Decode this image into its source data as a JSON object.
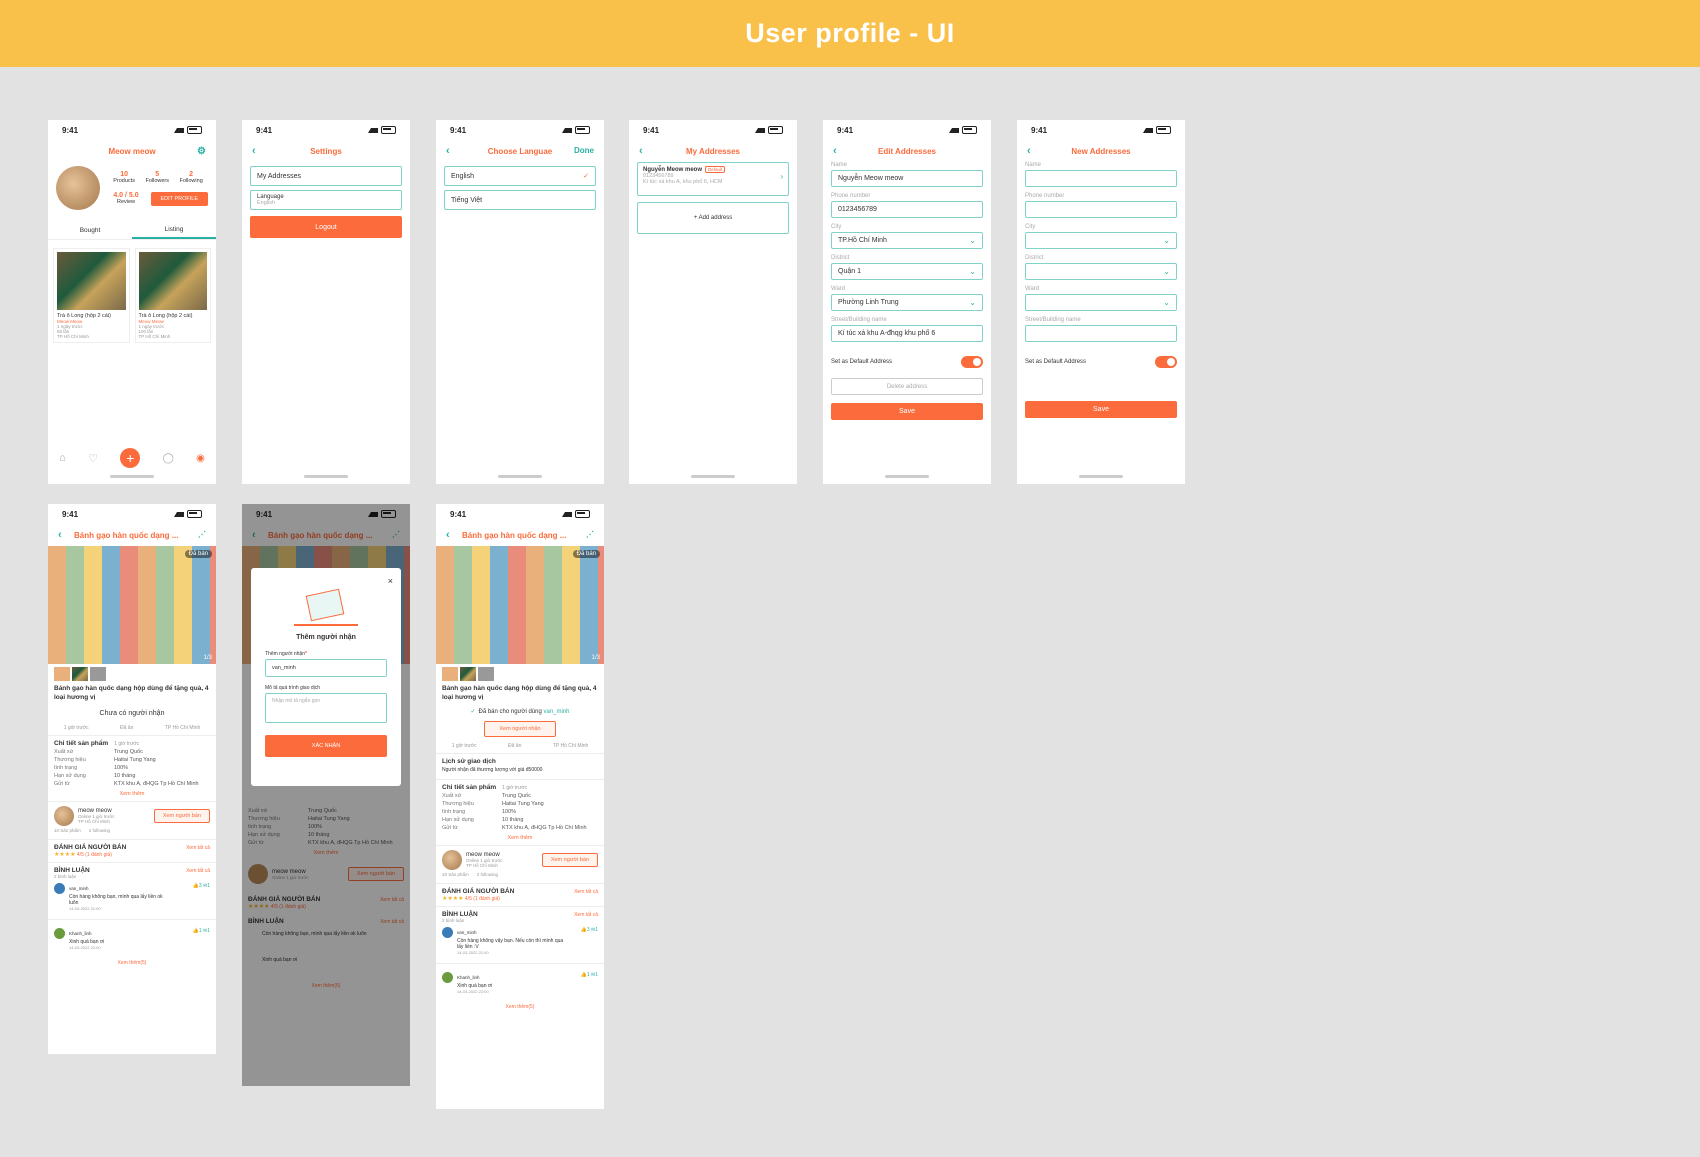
{
  "banner": {
    "title": "User profile - UI"
  },
  "status": {
    "time": "9:41"
  },
  "profile": {
    "title": "Meow meow",
    "stats": [
      {
        "value": "10",
        "label": "Products"
      },
      {
        "value": "5",
        "label": "Followers"
      },
      {
        "value": "2",
        "label": "Following"
      }
    ],
    "rating": "4.0 / 5.0",
    "rating_label": "Review",
    "edit_button": "EDIT PROFILE",
    "tabs": [
      "Bought",
      "Listing"
    ],
    "products": [
      {
        "name": "Trà ô Long (hộp 2 cái)",
        "seller": "Meow Meow",
        "time": "1 ngày trước",
        "sold": "65 lần",
        "location": "TP Hồ Chí Minh"
      },
      {
        "name": "Trà ô Long (hộp 2 cái)",
        "seller": "Meow Meow",
        "time": "1 ngày trước",
        "sold": "100 lần",
        "location": "TP Hồ Chí Minh"
      }
    ]
  },
  "settings": {
    "title": "Settings",
    "my_addresses": "My Addresses",
    "language": "Language",
    "language_value": "English",
    "logout": "Logout"
  },
  "choose_language": {
    "title": "Choose Languae",
    "done": "Done",
    "options": [
      "English",
      "Tiếng Việt"
    ]
  },
  "my_addresses": {
    "title": "My Addresses",
    "name": "Nguyễn Meow meow",
    "badge": "Default",
    "phone": "0123456789",
    "address": "Kí túc xá khu A, khu phố 6, HCM",
    "add": "+ Add address"
  },
  "edit_address": {
    "title": "Edit Addresses",
    "labels": {
      "name": "Name",
      "phone": "Phone number",
      "city": "City",
      "district": "District",
      "ward": "Ward",
      "street": "Street/Building name"
    },
    "values": {
      "name": "Nguyễn Meow meow",
      "phone": "0123456789",
      "city": "TP.Hồ Chí Minh",
      "district": "Quận 1",
      "ward": "Phường Linh Trung",
      "street": "Kí túc xá khu A-đhqg khu phố 6"
    },
    "default_label": "Set as Default Address",
    "delete": "Delete address",
    "save": "Save"
  },
  "new_address": {
    "title": "New Addresses",
    "default_label": "Set as Default Address",
    "save": "Save"
  },
  "product": {
    "title": "Bánh gạo hàn quốc dạng ...",
    "badge": "Đã bán",
    "counter": "1/3",
    "name": "Bánh gạo hàn quốc dạng hộp dùng để tặng quà, 4 loại hương vị",
    "no_receiver": "Chưa có người nhận",
    "meta": [
      "1 giờ trước",
      "Đã ăn",
      "TP Hồ Chí Minh"
    ],
    "details_title": "Chi tiết sản phẩm",
    "details_time": "1 giờ trước",
    "details": [
      {
        "k": "Xuất xứ",
        "v": "Trung Quốc"
      },
      {
        "k": "Thương hiệu",
        "v": "Haitai Tung Yang"
      },
      {
        "k": "tình trạng",
        "v": "100%"
      },
      {
        "k": "Hạn sử dụng",
        "v": "10 tháng"
      },
      {
        "k": "Gửi từ",
        "v": "KTX khu A, đHQG Tp Hồ Chí Minh"
      }
    ],
    "more": "Xem thêm",
    "seller_name": "meow meow",
    "seller_sub1": "Online 1 giờ trước",
    "seller_sub2": "TP Hồ Chí Minh",
    "seller_button": "Xem người bán",
    "seller_stats": [
      "10 Sản phẩm",
      "2 following"
    ],
    "review_title": "ĐÁNH GIÁ NGƯỜI BÁN",
    "review_score": "4/5 (1 đánh giá)",
    "see_all": "Xem tất cả",
    "comments_title": "BÌNH LUẬN",
    "comments_count": "2 bình luận",
    "comments": [
      {
        "user": "van_minh",
        "text": "Còn hàng không bạn, mình qua lấy liền ok luôn",
        "date": "14-03-2022 21:00",
        "likes": "3",
        "replies": "1"
      },
      {
        "user": "Khanh_linh",
        "text": "Xinh quá bạn ơi",
        "date": "14-03-2022 22:00",
        "likes": "1",
        "replies": "1"
      }
    ],
    "more_comments": "Xem thêm(5)",
    "sold_to": "Đã bán cho người dùng",
    "sold_user": "van_minh",
    "view_receiver": "Xem người nhận",
    "history_title": "Lịch sử giao dịch",
    "history_text": "Người nhận đã thương lượng với giá đ50000",
    "comment1_alt": "Còn hàng không vậy bạn. Nếu còn thì mình qua lấy liền :V"
  },
  "modal": {
    "title": "Thêm người nhận",
    "receiver_label": "Thêm người nhận",
    "receiver_value": "van_minh",
    "desc_label": "Mô tả quá trình giao dịch",
    "desc_placeholder": "Nhập mô tả ngắn gọn",
    "confirm": "XÁC NHẬN"
  }
}
